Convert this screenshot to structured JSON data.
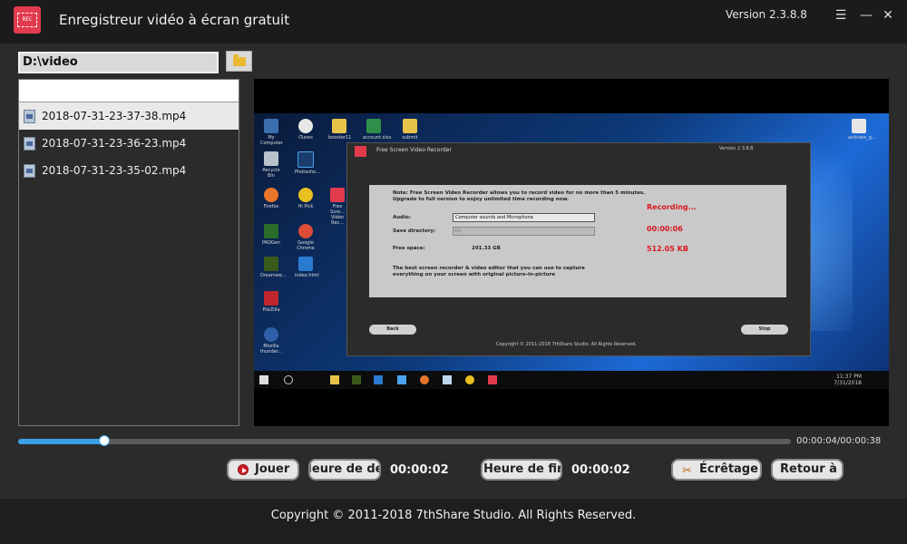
{
  "app": {
    "title": "Enregistreur vidéo à écran gratuit",
    "version": "Version 2.3.8.8",
    "logo_text": "REC"
  },
  "toolbar": {
    "path_value": "D:\\video",
    "folder_icon": "folder-icon"
  },
  "files": [
    {
      "name": "2018-07-31-23-37-38.mp4",
      "selected": true
    },
    {
      "name": "2018-07-31-23-36-23.mp4",
      "selected": false
    },
    {
      "name": "2018-07-31-23-35-02.mp4",
      "selected": false
    }
  ],
  "preview": {
    "inner_title": "Free Screen Video Recorder",
    "inner_version": "Version 2.3.8.8",
    "note_line1": "Note: Free Screen Video Recorder allows you to record video for no more than 5 minutes.",
    "note_line2": "Upgrade to full version to enjoy unlimited time recording now.",
    "audio_label": "Audio:",
    "audio_value": "Computer sounds and Microphone",
    "dir_label": "Save directory:",
    "dir_value": "D:\\",
    "space_label": "Free space:",
    "space_value": "201.33 GB",
    "status": "Recording...",
    "rec_time": "00:00:06",
    "rec_size": "512.05 KB",
    "promo_line1": "The best screen recorder & video editor that you can use to capture",
    "promo_line2": "everything on your screen with original picture-in-picture",
    "back_label": "Back",
    "stop_label": "Stop",
    "inner_copyright": "Copyright © 2011-2018 7thShare Studio. All Rights Reserved.",
    "clock_time": "11:37 PM",
    "clock_date": "7/31/2018",
    "desktop_icons": [
      "My Computer",
      "iTunes",
      "booster11",
      "account.xlsx",
      "submit",
      "Recycle Bin",
      "Photosho...",
      "Firefox",
      "Hi Pick",
      "Free Scre... Video Rec...",
      "PADGen",
      "Google Chrome",
      "Dreamwe...",
      "index.html",
      "FileZilla",
      "Mozilla thunder...",
      "activate_g..."
    ]
  },
  "playback": {
    "progress": 0.112,
    "time_display": "00:00:04/00:00:38"
  },
  "controls": {
    "play_label": "Jouer",
    "start_label": "Heure de début",
    "start_value": "00:00:02",
    "end_label": "Heure de fin",
    "end_value": "00:00:02",
    "trim_label": "Écrêtage",
    "back_label": "Retour à"
  },
  "footer": {
    "copyright": "Copyright © 2011-2018 7thShare Studio. All Rights Reserved."
  },
  "colors": {
    "accent": "#3aa0e8",
    "brand": "#e23b4e",
    "record_red": "#d8181e"
  }
}
